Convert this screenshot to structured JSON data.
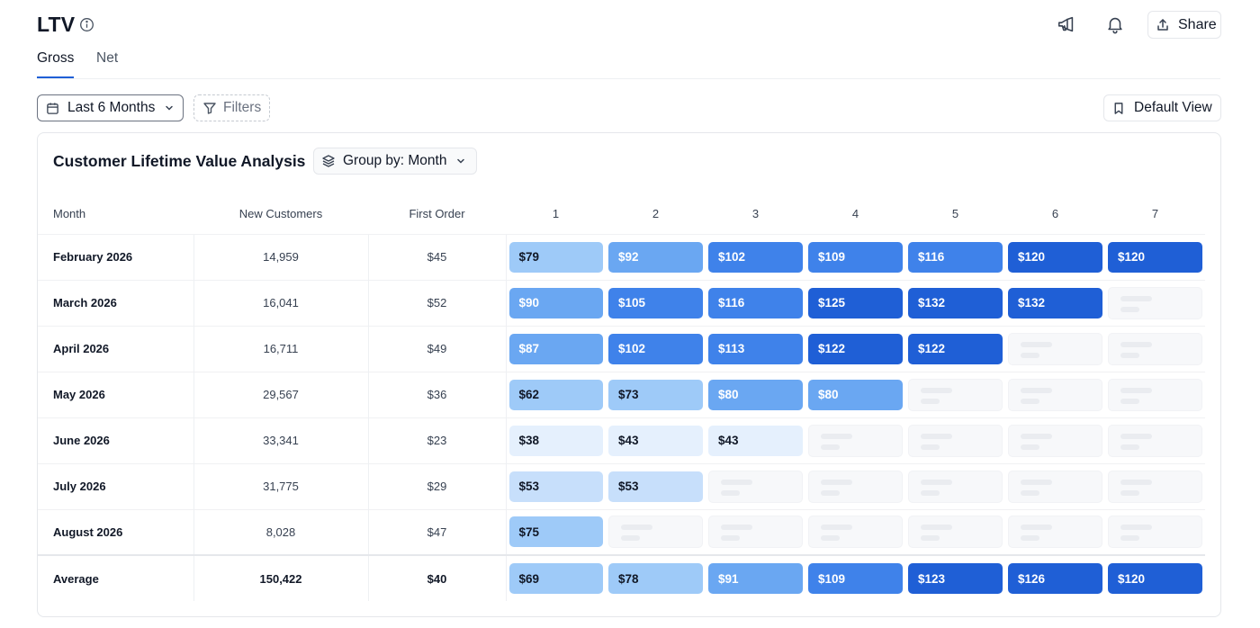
{
  "header": {
    "title": "LTV",
    "share_label": "Share"
  },
  "tabs": [
    {
      "label": "Gross",
      "active": true
    },
    {
      "label": "Net",
      "active": false
    }
  ],
  "toolbar": {
    "date_range": "Last 6 Months",
    "filters_label": "Filters",
    "view_label": "Default View"
  },
  "card": {
    "title": "Customer Lifetime Value Analysis",
    "group_by": "Group by: Month"
  },
  "table": {
    "columns": [
      "Month",
      "New Customers",
      "First Order",
      "1",
      "2",
      "3",
      "4",
      "5",
      "6",
      "7"
    ],
    "rows": [
      {
        "month": "February 2026",
        "new_customers": "14,959",
        "first_order": "$45",
        "values": [
          "$79",
          "$92",
          "$102",
          "$109",
          "$116",
          "$120",
          "$120"
        ]
      },
      {
        "month": "March 2026",
        "new_customers": "16,041",
        "first_order": "$52",
        "values": [
          "$90",
          "$105",
          "$116",
          "$125",
          "$132",
          "$132"
        ]
      },
      {
        "month": "April 2026",
        "new_customers": "16,711",
        "first_order": "$49",
        "values": [
          "$87",
          "$102",
          "$113",
          "$122",
          "$122"
        ]
      },
      {
        "month": "May 2026",
        "new_customers": "29,567",
        "first_order": "$36",
        "values": [
          "$62",
          "$73",
          "$80",
          "$80"
        ]
      },
      {
        "month": "June 2026",
        "new_customers": "33,341",
        "first_order": "$23",
        "values": [
          "$38",
          "$43",
          "$43"
        ]
      },
      {
        "month": "July 2026",
        "new_customers": "31,775",
        "first_order": "$29",
        "values": [
          "$53",
          "$53"
        ]
      },
      {
        "month": "August 2026",
        "new_customers": "8,028",
        "first_order": "$47",
        "values": [
          "$75"
        ]
      }
    ],
    "average": {
      "label": "Average",
      "new_customers": "150,422",
      "first_order": "$40",
      "values": [
        "$69",
        "$78",
        "$91",
        "$109",
        "$123",
        "$126",
        "$120"
      ]
    }
  },
  "colors": {
    "accent": "#1f5fd6",
    "heat_scale": [
      "#e5f0fd",
      "#c7dffb",
      "#9ecaf8",
      "#6aa7f2",
      "#3f82ea",
      "#1f5fd6"
    ]
  },
  "icons": {
    "title_info": "info-icon",
    "announce": "megaphone-icon",
    "notify": "bell-icon",
    "share": "share-icon",
    "date": "calendar-icon",
    "filters": "filter-icon",
    "view": "bookmark-icon",
    "group": "layers-icon"
  }
}
